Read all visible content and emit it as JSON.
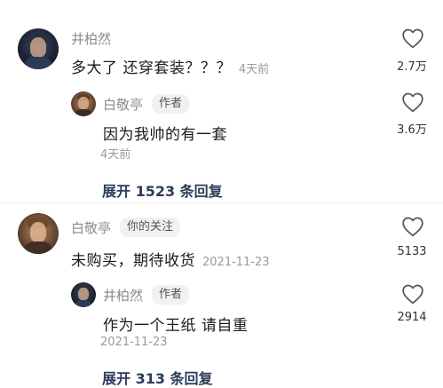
{
  "comments": [
    {
      "user": "井柏然",
      "text": "多大了 还穿套装？？？",
      "time": "4天前",
      "likes": "2.7万",
      "reply": {
        "user": "白敬亭",
        "tag": "作者",
        "text": "因为我帅的有一套",
        "time": "4天前",
        "likes": "3.6万"
      },
      "expand": "展开 1523 条回复"
    },
    {
      "user": "白敬亭",
      "tag": "你的关注",
      "text": "未购买，期待收货",
      "time": "2021-11-23",
      "likes": "5133",
      "reply": {
        "user": "井柏然",
        "tag": "作者",
        "text": "作为一个王纸 请自重",
        "time": "2021-11-23",
        "likes": "2914"
      },
      "expand": "展开 313 条回复"
    }
  ],
  "icons": {
    "like": "heart-outline-icon"
  },
  "colors": {
    "expand_text": "#2d3c5a",
    "muted_text": "#8a8a8a"
  }
}
